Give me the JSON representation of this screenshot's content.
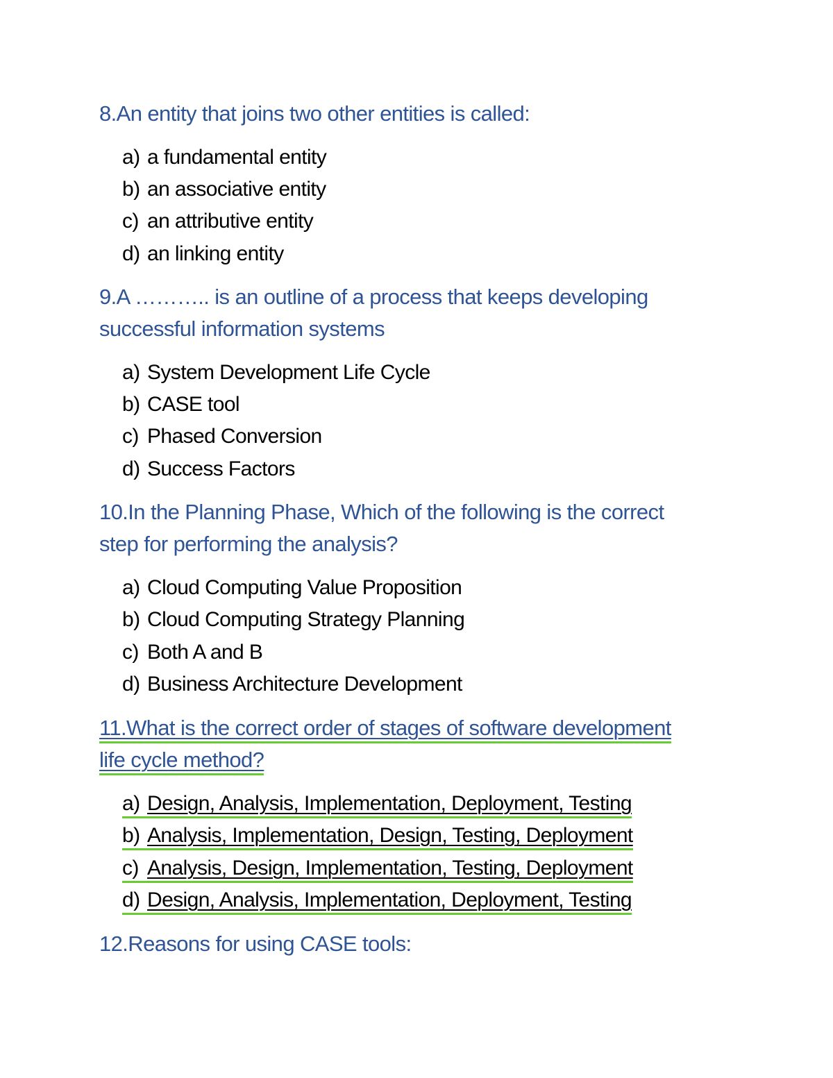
{
  "document": {
    "questions": [
      {
        "number": "8.",
        "lines": [
          "8.An entity that joins two other entities is called:"
        ],
        "options": [
          {
            "letter": "a)",
            "text": "a fundamental entity"
          },
          {
            "letter": "b)",
            "text": "an associative entity"
          },
          {
            "letter": "c)",
            "text": "an attributive entity"
          },
          {
            "letter": "d)",
            "text": "an linking entity"
          }
        ]
      },
      {
        "number": "9.",
        "lines": [
          "9.A ……….. is an outline of a process that keeps developing",
          "successful information systems"
        ],
        "options": [
          {
            "letter": "a)",
            "text": "System Development Life Cycle"
          },
          {
            "letter": "b)",
            "text": "CASE tool"
          },
          {
            "letter": "c)",
            "text": "Phased Conversion"
          },
          {
            "letter": "d)",
            "text": "Success Factors"
          }
        ]
      },
      {
        "number": "10.",
        "lines": [
          "10.In the Planning Phase, Which of the following is the correct",
          "step for performing the analysis?"
        ],
        "options": [
          {
            "letter": "a)",
            "text": "Cloud Computing Value Proposition"
          },
          {
            "letter": "b)",
            "text": "Cloud Computing Strategy Planning"
          },
          {
            "letter": "c)",
            "text": "Both A and B"
          },
          {
            "letter": "d)",
            "text": "Business Architecture Development"
          }
        ]
      },
      {
        "number": "11.",
        "marked": true,
        "lines": [
          "11.What is the correct order of stages of software development",
          "life cycle method?"
        ],
        "options": [
          {
            "letter": "a)",
            "text": "Design, Analysis, Implementation, Deployment, Testing"
          },
          {
            "letter": "b)",
            "text": "Analysis, Implementation, Design, Testing, Deployment"
          },
          {
            "letter": "c)",
            "text": "Analysis, Design, Implementation, Testing, Deployment"
          },
          {
            "letter": "d)",
            "text": "Design, Analysis, Implementation, Deployment, Testing"
          }
        ]
      },
      {
        "number": "12.",
        "lines": [
          "12.Reasons for using CASE tools:"
        ],
        "options": []
      }
    ],
    "colors": {
      "heading": "#2F5496",
      "body": "#000000",
      "highlight_underline": "#66CC33"
    }
  }
}
